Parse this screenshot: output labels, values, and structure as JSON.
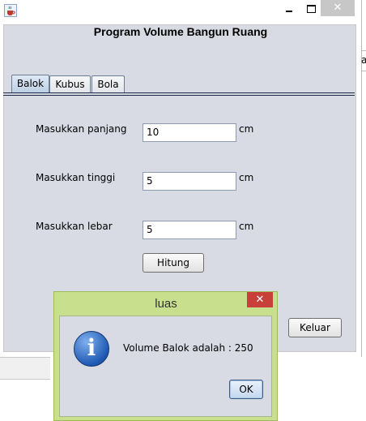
{
  "window": {
    "close_glyph": "✕",
    "icon": "java-cup-icon"
  },
  "app_title": "Program Volume Bangun Ruang",
  "tabs": [
    {
      "label": "Balok",
      "active": true
    },
    {
      "label": "Kubus",
      "active": false
    },
    {
      "label": "Bola",
      "active": false
    }
  ],
  "form": {
    "panjang": {
      "label": "Masukkan panjang",
      "value": "10",
      "unit": "cm"
    },
    "tinggi": {
      "label": "Masukkan tinggi",
      "value": "5",
      "unit": "cm"
    },
    "lebar": {
      "label": "Masukkan lebar",
      "value": "5",
      "unit": "cm"
    },
    "hitung_label": "Hitung",
    "keluar_label": "Keluar"
  },
  "background_edge_text": "a",
  "dialog": {
    "title": "luas",
    "close_glyph": "✕",
    "icon": "information-icon",
    "icon_glyph": "i",
    "message": "Volume Balok adalah : 250",
    "ok_label": "OK"
  },
  "colors": {
    "dialog_frame": "#c8df8d",
    "dialog_close": "#c7413a",
    "panel_bg": "#d8dbe4",
    "info_icon": "#1f59b4"
  }
}
